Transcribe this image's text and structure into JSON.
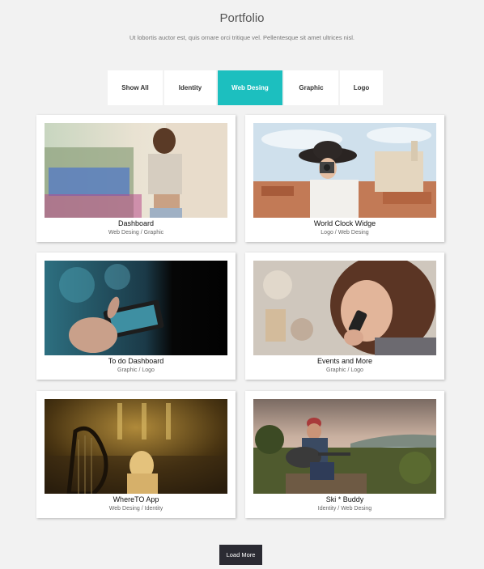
{
  "header": {
    "title": "Portfolio",
    "subtitle": "Ut lobortis auctor est, quis ornare orci tritique vel. Pellentesque sit amet ultrices nisl."
  },
  "filters": [
    {
      "label": "Show All",
      "active": false
    },
    {
      "label": "Identity",
      "active": false
    },
    {
      "label": "Web Desing",
      "active": true
    },
    {
      "label": "Graphic",
      "active": false
    },
    {
      "label": "Logo",
      "active": false
    }
  ],
  "items": [
    {
      "title": "Dashboard",
      "categories": "Web Desing / Graphic",
      "image": "woman-in-crop-top-photo"
    },
    {
      "title": "World Clock Widge",
      "categories": "Logo / Web Desing",
      "image": "woman-with-camera-photo"
    },
    {
      "title": "To do Dashboard",
      "categories": "Graphic / Logo",
      "image": "hand-holding-phone-photo"
    },
    {
      "title": "Events and More",
      "categories": "Graphic / Logo",
      "image": "woman-on-phone-photo"
    },
    {
      "title": "WhereTO App",
      "categories": "Web Desing / Identity",
      "image": "harp-player-photo"
    },
    {
      "title": "Ski * Buddy",
      "categories": "Identity / Web Desing",
      "image": "guitarist-on-hill-photo"
    }
  ],
  "load_more_label": "Load More",
  "colors": {
    "accent": "#1cbfbf",
    "button_dark": "#2b2b33",
    "background": "#f2f2f2"
  }
}
